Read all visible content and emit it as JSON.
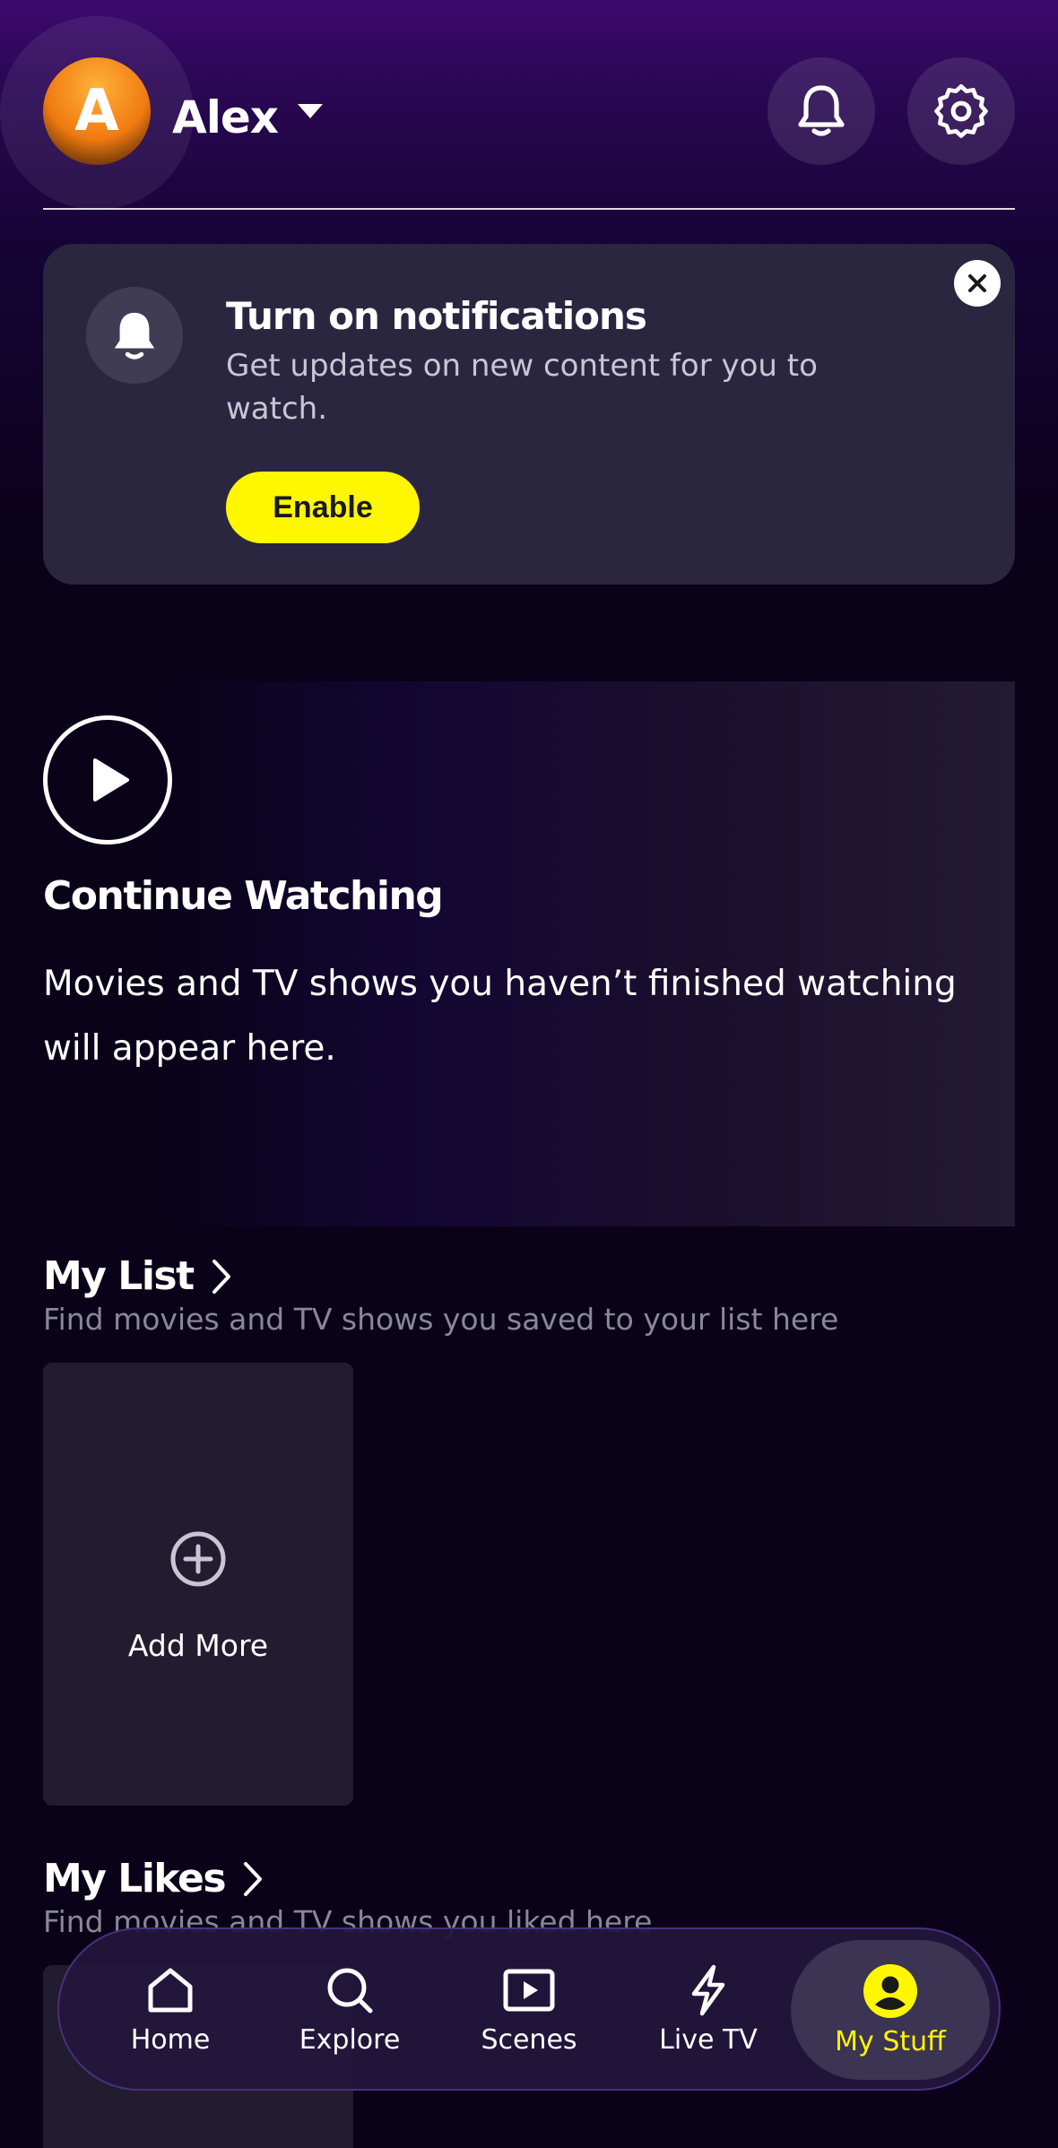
{
  "header": {
    "avatar_letter": "A",
    "profile_name": "Alex",
    "icons": {
      "notifications": "bell-icon",
      "settings": "gear-icon",
      "menu": "chevron-down-icon"
    }
  },
  "notification_card": {
    "title": "Turn on notifications",
    "body": "Get updates on new content for you to watch.",
    "enable_label": "Enable",
    "icons": {
      "bell": "bell-icon",
      "close": "close-icon"
    }
  },
  "continue_watching": {
    "title": "Continue Watching",
    "body": "Movies and TV shows you haven’t finished watching will appear here.",
    "icon": "play-icon"
  },
  "my_list": {
    "title": "My List",
    "subtitle": "Find movies and TV shows you saved to your list here",
    "add_more_label": "Add More",
    "icon": "plus-circle-icon"
  },
  "my_likes": {
    "title": "My Likes",
    "subtitle": "Find movies and TV shows you liked here"
  },
  "bottom_nav": {
    "items": [
      {
        "label": "Home",
        "icon": "home-icon"
      },
      {
        "label": "Explore",
        "icon": "search-icon"
      },
      {
        "label": "Scenes",
        "icon": "play-square-icon"
      },
      {
        "label": "Live TV",
        "icon": "lightning-icon"
      },
      {
        "label": "My Stuff",
        "icon": "profile-icon"
      }
    ],
    "active_index": 4
  },
  "colors": {
    "accent_yellow": "#fff700",
    "card_bg": "#2b2640",
    "background": "#0a0219",
    "header_purple": "#3d0a6e"
  }
}
